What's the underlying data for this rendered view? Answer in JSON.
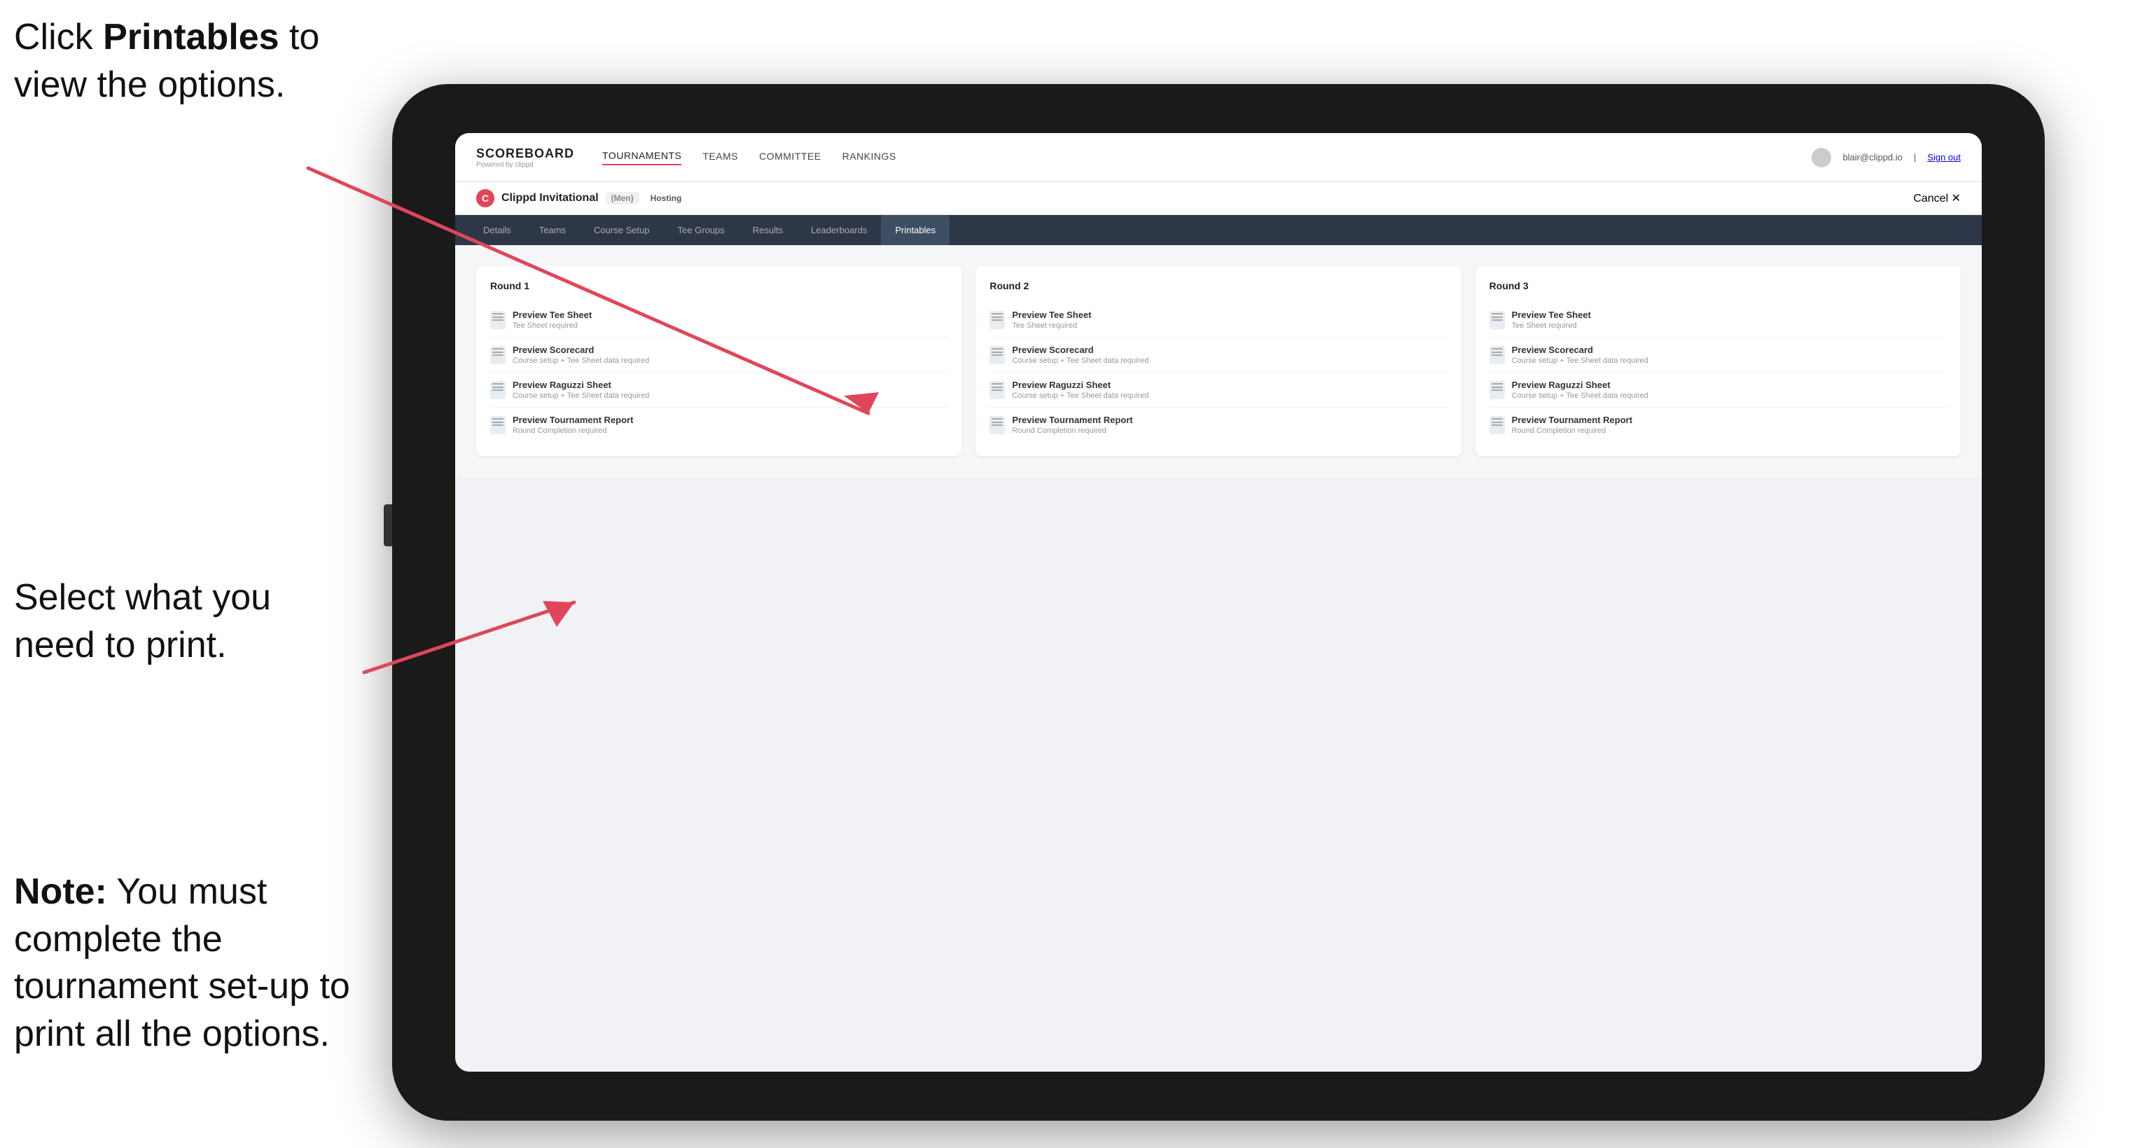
{
  "annotations": {
    "top_line1": "Click ",
    "top_bold": "Printables",
    "top_line2": " to",
    "top_line3": "view the options.",
    "middle": "Select what you need to print.",
    "bottom_bold": "Note:",
    "bottom_rest": " You must complete the tournament set-up to print all the options."
  },
  "header": {
    "logo_title": "SCOREBOARD",
    "logo_sub": "Powered by clippd",
    "nav": [
      "TOURNAMENTS",
      "TEAMS",
      "COMMITTEE",
      "RANKINGS"
    ],
    "user_email": "blair@clippd.io",
    "sign_out": "Sign out"
  },
  "tournament": {
    "name": "Clippd Invitational",
    "gender": "(Men)",
    "status": "Hosting",
    "cancel": "Cancel"
  },
  "sub_tabs": {
    "items": [
      "Details",
      "Teams",
      "Course Setup",
      "Tee Groups",
      "Results",
      "Leaderboards",
      "Printables"
    ],
    "active": "Printables"
  },
  "rounds": [
    {
      "title": "Round 1",
      "items": [
        {
          "title": "Preview Tee Sheet",
          "sub": "Tee Sheet required"
        },
        {
          "title": "Preview Scorecard",
          "sub": "Course setup + Tee Sheet data required"
        },
        {
          "title": "Preview Raguzzi Sheet",
          "sub": "Course setup + Tee Sheet data required"
        },
        {
          "title": "Preview Tournament Report",
          "sub": "Round Completion required"
        }
      ]
    },
    {
      "title": "Round 2",
      "items": [
        {
          "title": "Preview Tee Sheet",
          "sub": "Tee Sheet required"
        },
        {
          "title": "Preview Scorecard",
          "sub": "Course setup + Tee Sheet data required"
        },
        {
          "title": "Preview Raguzzi Sheet",
          "sub": "Course setup + Tee Sheet data required"
        },
        {
          "title": "Preview Tournament Report",
          "sub": "Round Completion required"
        }
      ]
    },
    {
      "title": "Round 3",
      "items": [
        {
          "title": "Preview Tee Sheet",
          "sub": "Tee Sheet required"
        },
        {
          "title": "Preview Scorecard",
          "sub": "Course setup + Tee Sheet data required"
        },
        {
          "title": "Preview Raguzzi Sheet",
          "sub": "Course setup + Tee Sheet data required"
        },
        {
          "title": "Preview Tournament Report",
          "sub": "Round Completion required"
        }
      ]
    }
  ],
  "colors": {
    "accent": "#e0465a",
    "nav_bg": "#2d3748",
    "active_tab_bg": "#3d4e63"
  }
}
